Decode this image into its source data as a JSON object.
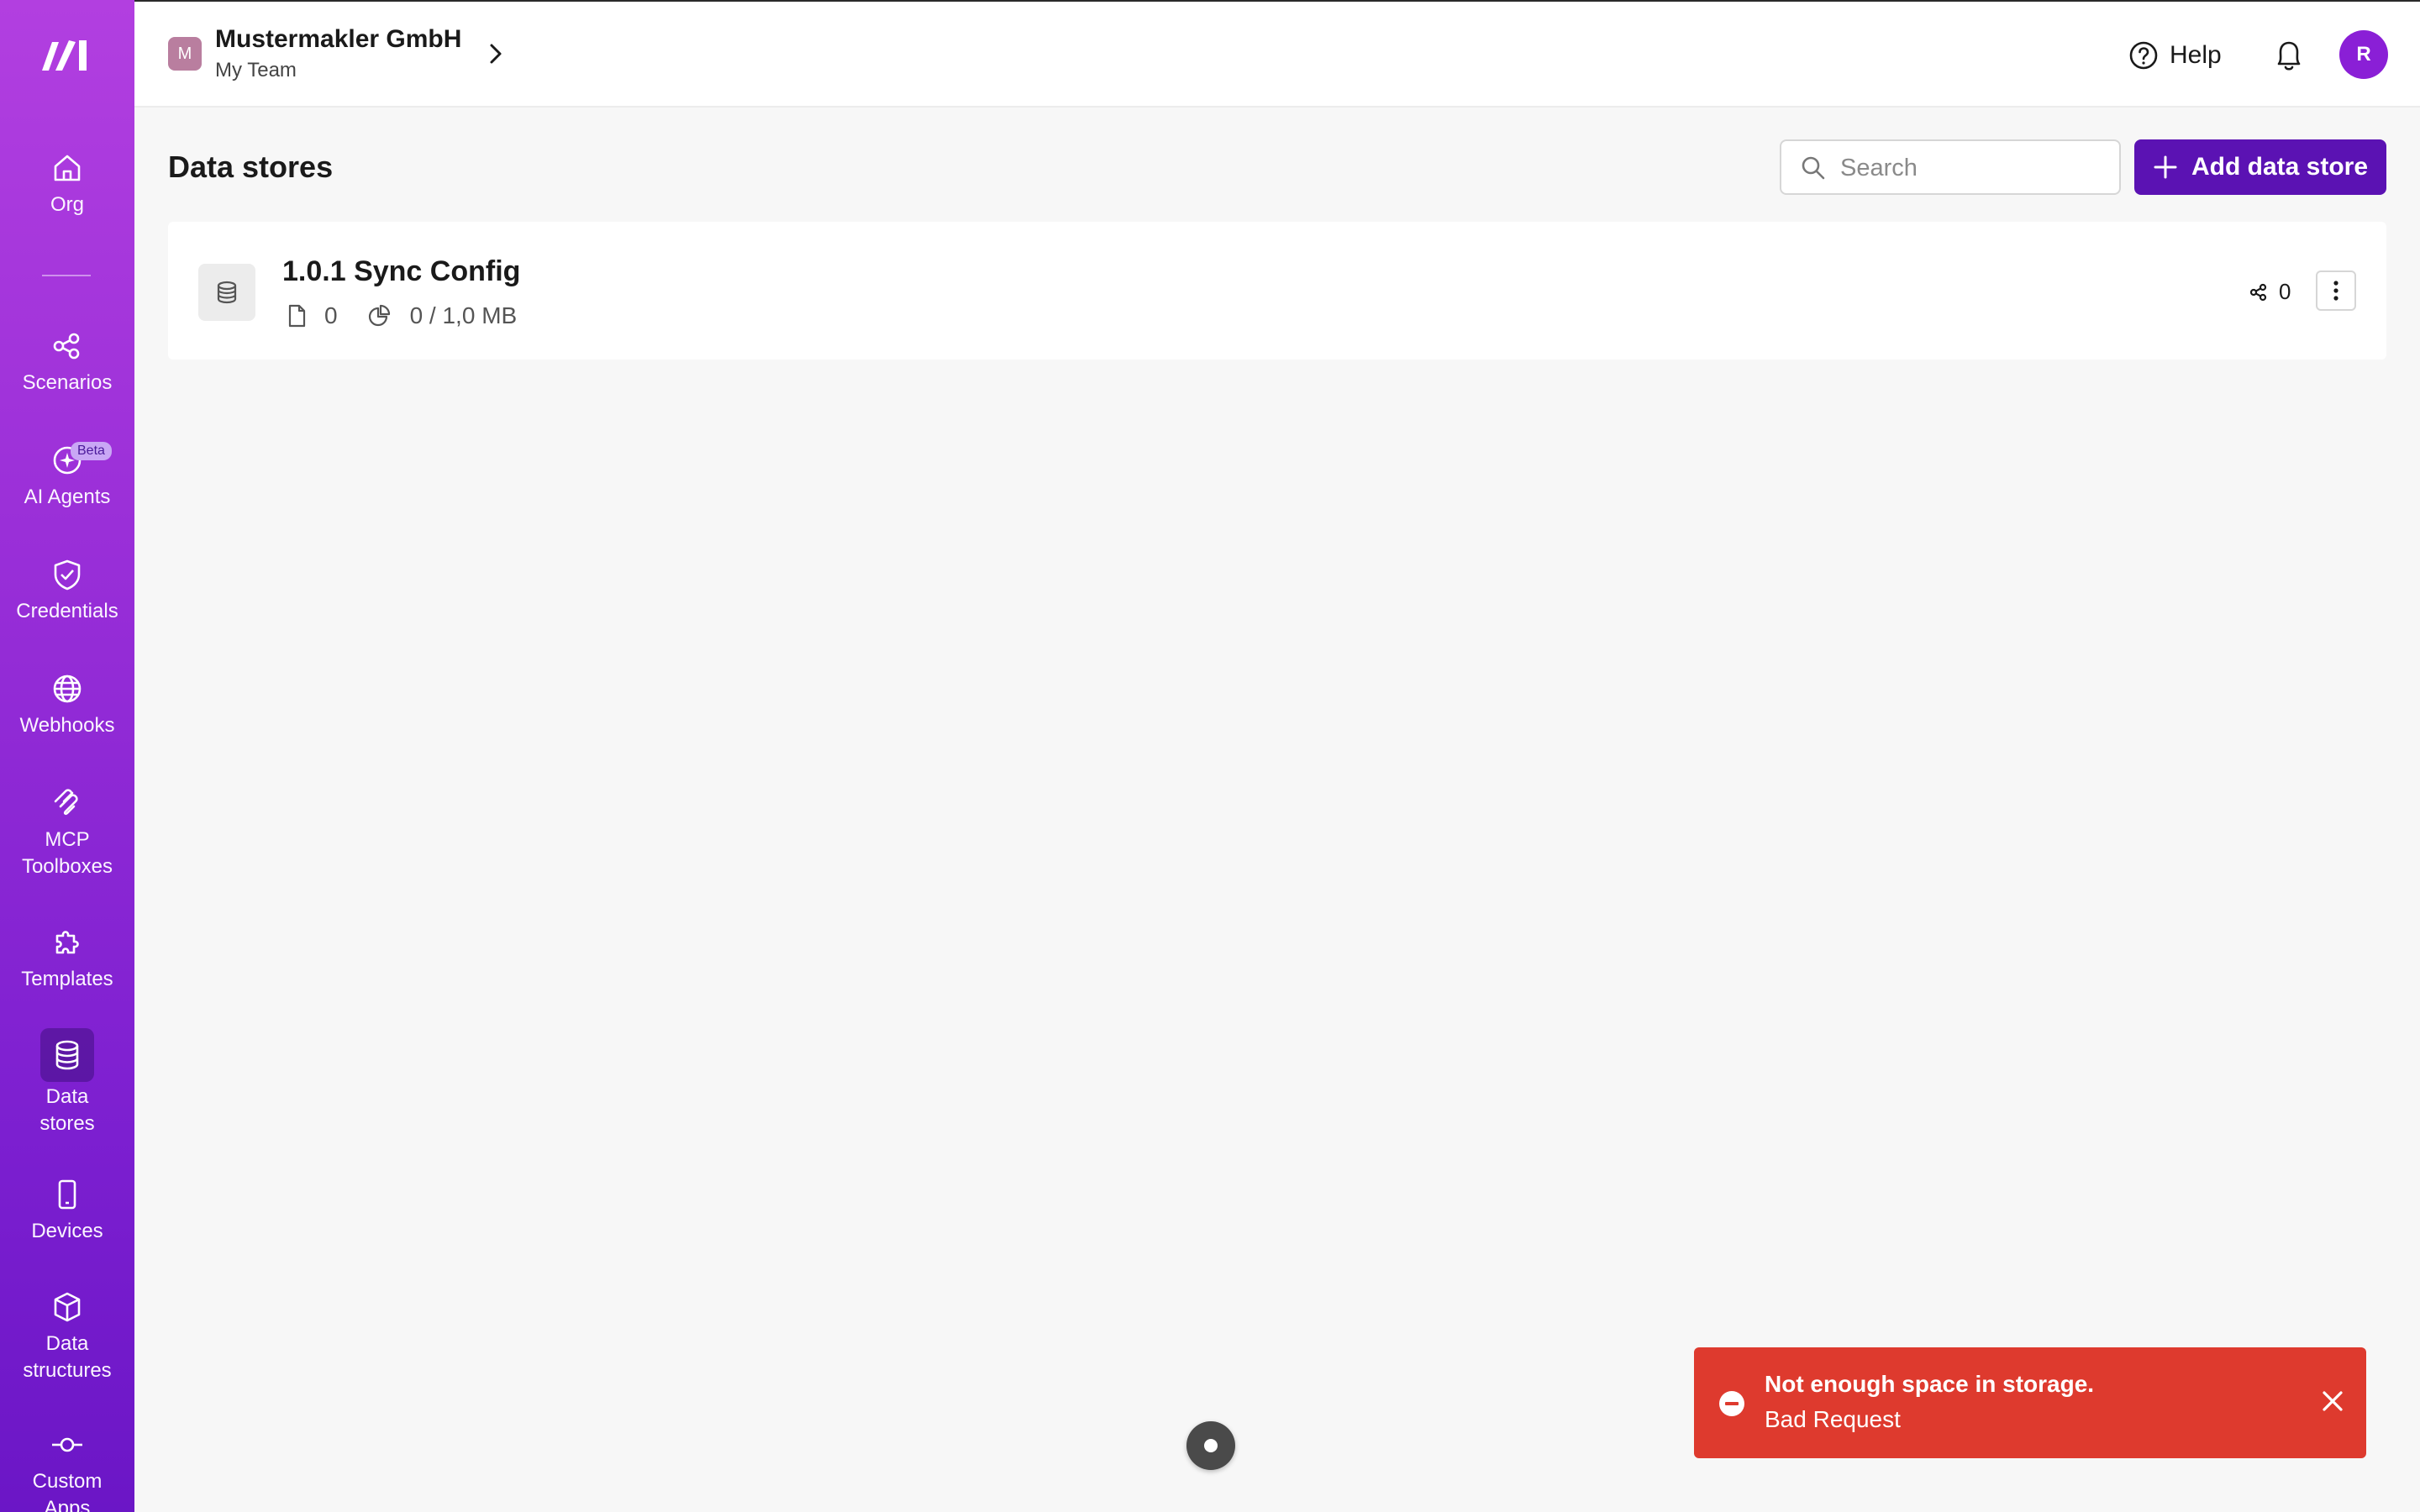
{
  "sidebar": {
    "items": [
      {
        "label": "Org",
        "icon": "home-icon"
      },
      {
        "label": "Scenarios",
        "icon": "share-nodes-icon"
      },
      {
        "label": "AI Agents",
        "icon": "sparkle-icon",
        "badge": "Beta"
      },
      {
        "label": "Credentials",
        "icon": "shield-check-icon"
      },
      {
        "label": "Webhooks",
        "icon": "globe-icon"
      },
      {
        "label": "MCP\nToolboxes",
        "icon": "mcp-icon"
      },
      {
        "label": "Templates",
        "icon": "puzzle-icon"
      },
      {
        "label": "Data\nstores",
        "icon": "database-icon",
        "active": true
      },
      {
        "label": "Devices",
        "icon": "mobile-icon"
      },
      {
        "label": "Data\nstructures",
        "icon": "cube-icon"
      },
      {
        "label": "Custom\nApps",
        "icon": "commit-icon"
      }
    ]
  },
  "header": {
    "org_initial": "M",
    "org_name": "Mustermakler GmbH",
    "team_name": "My Team",
    "help_label": "Help",
    "avatar_initial": "R"
  },
  "main": {
    "title": "Data stores",
    "search_placeholder": "Search",
    "add_button_label": "Add data store",
    "stores": [
      {
        "name": "1.0.1 Sync Config",
        "records": "0",
        "size": "0 / 1,0 MB",
        "connections": "0"
      }
    ]
  },
  "toast": {
    "title": "Not enough space in storage.",
    "message": "Bad Request",
    "color": "#de3a2e"
  },
  "colors": {
    "sidebar_top": "#b23fe0",
    "sidebar_bottom": "#6b16c6",
    "accent": "#5b12b3"
  }
}
